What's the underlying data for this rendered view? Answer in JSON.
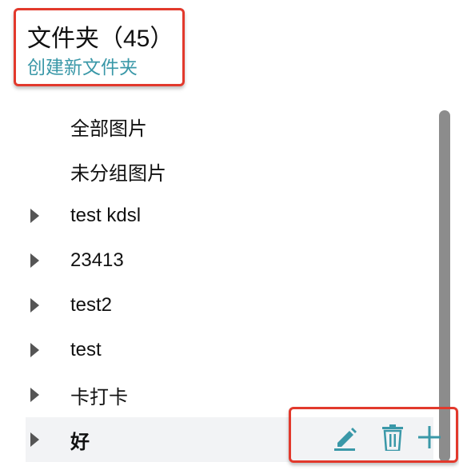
{
  "header": {
    "title": "文件夹（45）",
    "create_link": "创建新文件夹"
  },
  "folders": [
    {
      "label": "全部图片",
      "expandable": false,
      "selected": false
    },
    {
      "label": "未分组图片",
      "expandable": false,
      "selected": false
    },
    {
      "label": "test kdsl",
      "expandable": true,
      "selected": false
    },
    {
      "label": "23413",
      "expandable": true,
      "selected": false
    },
    {
      "label": "test2",
      "expandable": true,
      "selected": false
    },
    {
      "label": "test",
      "expandable": true,
      "selected": false
    },
    {
      "label": "卡打卡",
      "expandable": true,
      "selected": false
    },
    {
      "label": "好",
      "expandable": true,
      "selected": true
    }
  ],
  "actions": {
    "icons": [
      "edit-icon",
      "trash-icon",
      "add-icon"
    ],
    "color": "#3a98a8"
  },
  "colors": {
    "accent": "#3a98a8",
    "highlight_border": "#e2392c"
  }
}
